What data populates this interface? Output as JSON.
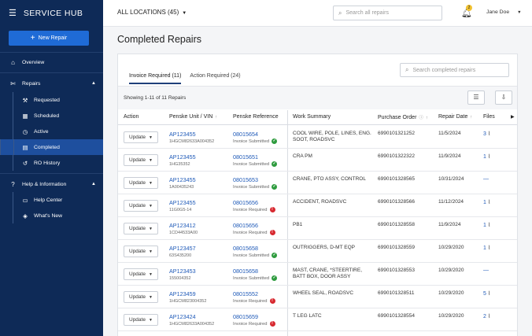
{
  "app": {
    "brand": "SERVICE HUB"
  },
  "sidebar": {
    "new_repair": "New Repair",
    "overview": "Overview",
    "repairs": "Repairs",
    "repairs_sub": [
      "Requested",
      "Scheduled",
      "Active",
      "Completed",
      "RO History"
    ],
    "help": "Help & Information",
    "help_sub": [
      "Help Center",
      "What's New"
    ]
  },
  "topbar": {
    "location": "ALL LOCATIONS (45)",
    "search_placeholder": "Search all repairs",
    "notification_count": "2",
    "user": "Jane Doe"
  },
  "page": {
    "title": "Completed Repairs"
  },
  "tabs": [
    {
      "label": "Invoice Required (11)",
      "active": true
    },
    {
      "label": "Action Required (24)",
      "active": false
    }
  ],
  "card": {
    "search_placeholder": "Search completed repairs",
    "showing": "Showing 1-11 of 11 Repairs"
  },
  "columns": {
    "action": "Action",
    "unit": "Penske Unit / VIN",
    "reference": "Penske Reference",
    "work": "Work Summary",
    "po": "Purchase Order",
    "date": "Repair Date",
    "files": "Files"
  },
  "rows": [
    {
      "unit": "AP123455",
      "vin": "1HGCM82633A004352",
      "ref": "08015654",
      "status": "Invoice Submitted",
      "ok": true,
      "work": "COOL WIRE, POLE, LINES, ENG. SOOT, ROADSVC",
      "po": "6990101321252",
      "date": "11/5/2024",
      "files": "3"
    },
    {
      "unit": "AP123455",
      "vin": "1HG35352",
      "ref": "08015651",
      "status": "Invoice Submitted",
      "ok": true,
      "work": "CRA PM",
      "po": "6990101322322",
      "date": "11/9/2024",
      "files": "1"
    },
    {
      "unit": "AP123455",
      "vin": "1A00435243",
      "ref": "08015653",
      "status": "Invoice Submitted",
      "ok": true,
      "work": "CRANE, PTO ASSY, CONTROL",
      "po": "6990101328565",
      "date": "10/31/2024",
      "files": "—"
    },
    {
      "unit": "AP123455",
      "vin": "11G0G5-14",
      "ref": "08015656",
      "status": "Invoice Required",
      "ok": false,
      "work": "ACCIDENT, ROADSVC",
      "po": "6990101328566",
      "date": "11/12/2024",
      "files": "1"
    },
    {
      "unit": "AP123412",
      "vin": "1CD44533A00",
      "ref": "08015656",
      "status": "Invoice Required",
      "ok": false,
      "work": "PB1",
      "po": "6990101328558",
      "date": "11/9/2024",
      "files": "1"
    },
    {
      "unit": "AP123457",
      "vin": "63S435200",
      "ref": "08015658",
      "status": "Invoice Submitted",
      "ok": true,
      "work": "OUTRIGGERS, D-MT EQP",
      "po": "6990101328559",
      "date": "10/29/2020",
      "files": "1"
    },
    {
      "unit": "AP123453",
      "vin": "155004352",
      "ref": "08015658",
      "status": "Invoice Submitted",
      "ok": true,
      "work": "MAST, CRANE, *STEERTIRE, BATT BOX, DOOR ASSY",
      "po": "6990101328553",
      "date": "10/29/2020",
      "files": "—"
    },
    {
      "unit": "AP123459",
      "vin": "1HGCM823004352",
      "ref": "08015552",
      "status": "Invoice Required",
      "ok": false,
      "work": "WHEEL SEAL, ROADSVC",
      "po": "6990101328511",
      "date": "10/29/2020",
      "files": "5"
    },
    {
      "unit": "AP123424",
      "vin": "1HGCM82633A004352",
      "ref": "08015659",
      "status": "Invoice Required",
      "ok": false,
      "work": "T LEG LATC",
      "po": "6990101328554",
      "date": "10/29/2020",
      "files": "2"
    }
  ],
  "update_label": "Update",
  "colors": {
    "sidebar": "#0e2a57",
    "accent": "#1f6bd6",
    "link": "#1f5ab8",
    "ok": "#2e9b3e",
    "error": "#d7282f"
  }
}
